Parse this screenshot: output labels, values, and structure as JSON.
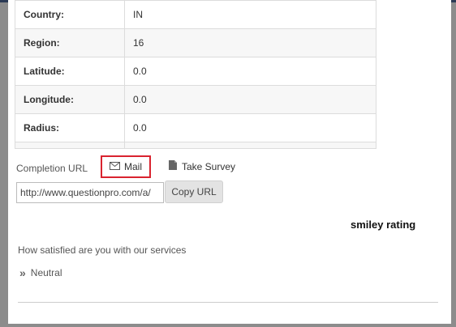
{
  "info_table": {
    "rows": [
      {
        "key": "Country:",
        "value": "IN"
      },
      {
        "key": "Region:",
        "value": "16"
      },
      {
        "key": "Latitude:",
        "value": "0.0"
      },
      {
        "key": "Longitude:",
        "value": "0.0"
      },
      {
        "key": "Radius:",
        "value": "0.0"
      }
    ]
  },
  "completion": {
    "label": "Completion URL",
    "mail_label": "Mail",
    "take_survey_label": "Take Survey",
    "url_value": "http://www.questionpro.com/a/",
    "copy_label": "Copy URL"
  },
  "question_block": {
    "title": "smiley rating",
    "question": "How satisfied are you with our services",
    "answer": "Neutral"
  },
  "icons": {
    "mail": "envelope-icon",
    "take_survey": "document-icon",
    "answer": "double-chevron-right-icon"
  },
  "colors": {
    "highlight_border": "#d9232f",
    "top_bar": "#2b3a55"
  }
}
